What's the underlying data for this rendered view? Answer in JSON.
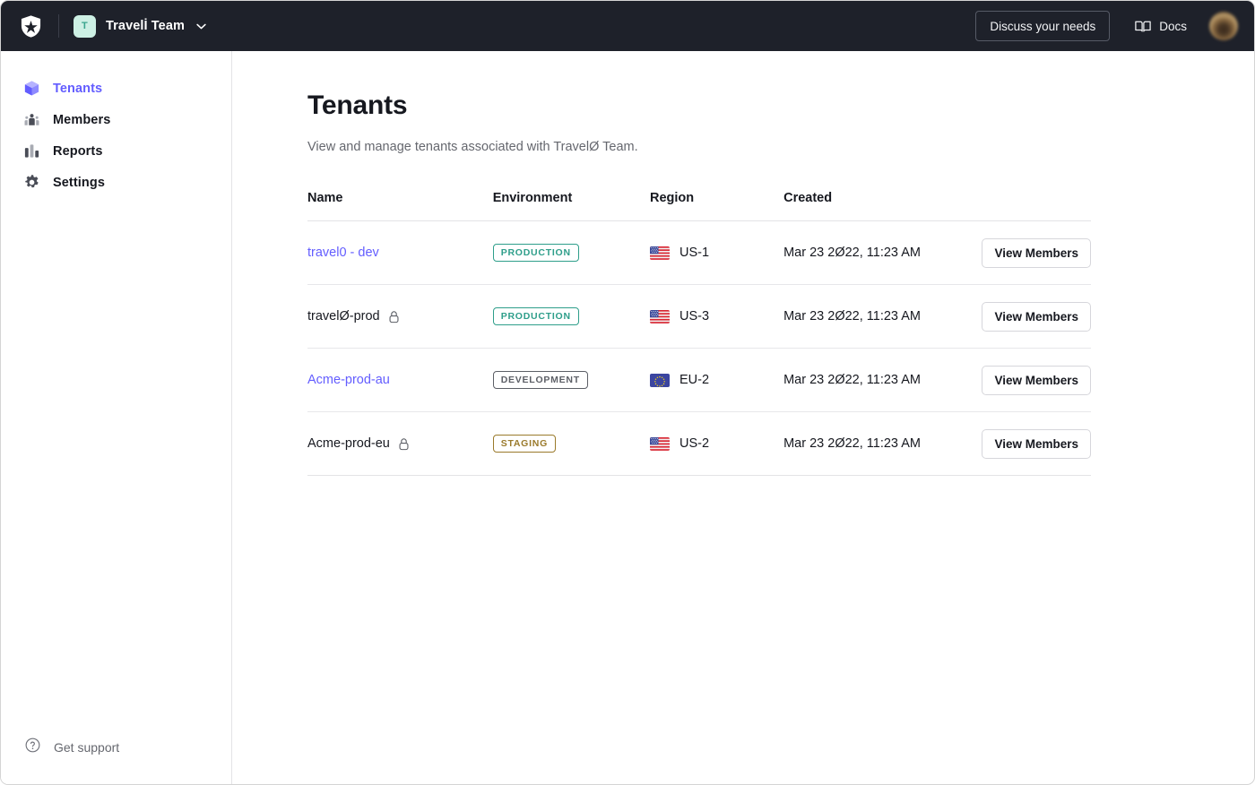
{
  "topbar": {
    "logo_icon": "auth0-logo-icon",
    "team_avatar_initial": "T",
    "team_name": "Travelİ Team",
    "chevron_icon": "chevron-down-icon",
    "discuss_label": "Discuss your needs",
    "docs_label": "Docs",
    "docs_icon": "book-icon",
    "avatar_label": "user-avatar"
  },
  "sidebar": {
    "items": [
      {
        "label": "Tenants",
        "icon": "cube-icon",
        "active": true
      },
      {
        "label": "Members",
        "icon": "people-icon",
        "active": false
      },
      {
        "label": "Reports",
        "icon": "bar-chart-icon",
        "active": false
      },
      {
        "label": "Settings",
        "icon": "gear-icon",
        "active": false
      }
    ],
    "support": {
      "label": "Get support",
      "icon": "question-circle-icon"
    }
  },
  "main": {
    "title": "Tenants",
    "subtitle": "View and manage tenants associated with TravelØ Team.",
    "table": {
      "columns": [
        "Name",
        "Environment",
        "Region",
        "Created",
        ""
      ],
      "rows": [
        {
          "name": "travel0 - dev",
          "is_link": true,
          "locked": false,
          "environment": "PRODUCTION",
          "env_kind": "production",
          "region_flag": "us-flag-icon",
          "region": "US-1",
          "created": "Mar 23 2Ø22, 11:23 AM",
          "action": "View Members"
        },
        {
          "name": "travelØ-prod",
          "is_link": false,
          "locked": true,
          "environment": "PRODUCTION",
          "env_kind": "production",
          "region_flag": "us-flag-icon",
          "region": "US-3",
          "created": "Mar 23 2Ø22, 11:23 AM",
          "action": "View Members"
        },
        {
          "name": "Acme-prod-au",
          "is_link": true,
          "locked": false,
          "environment": "DEVELOPMENT",
          "env_kind": "development",
          "region_flag": "eu-flag-icon",
          "region": "EU-2",
          "created": "Mar 23 2Ø22, 11:23 AM",
          "action": "View Members"
        },
        {
          "name": "Acme-prod-eu",
          "is_link": false,
          "locked": true,
          "environment": "STAGING",
          "env_kind": "staging",
          "region_flag": "us-flag-icon",
          "region": "US-2",
          "created": "Mar 23 2Ø22, 11:23 AM",
          "action": "View Members"
        }
      ]
    }
  },
  "colors": {
    "topbar_bg": "#1e212a",
    "accent_purple": "#635dff",
    "production_teal": "#2e9e8a",
    "development_gray": "#5c5f66",
    "staging_gold": "#9a7a2b",
    "avatar_mint": "#cdf0e4"
  }
}
